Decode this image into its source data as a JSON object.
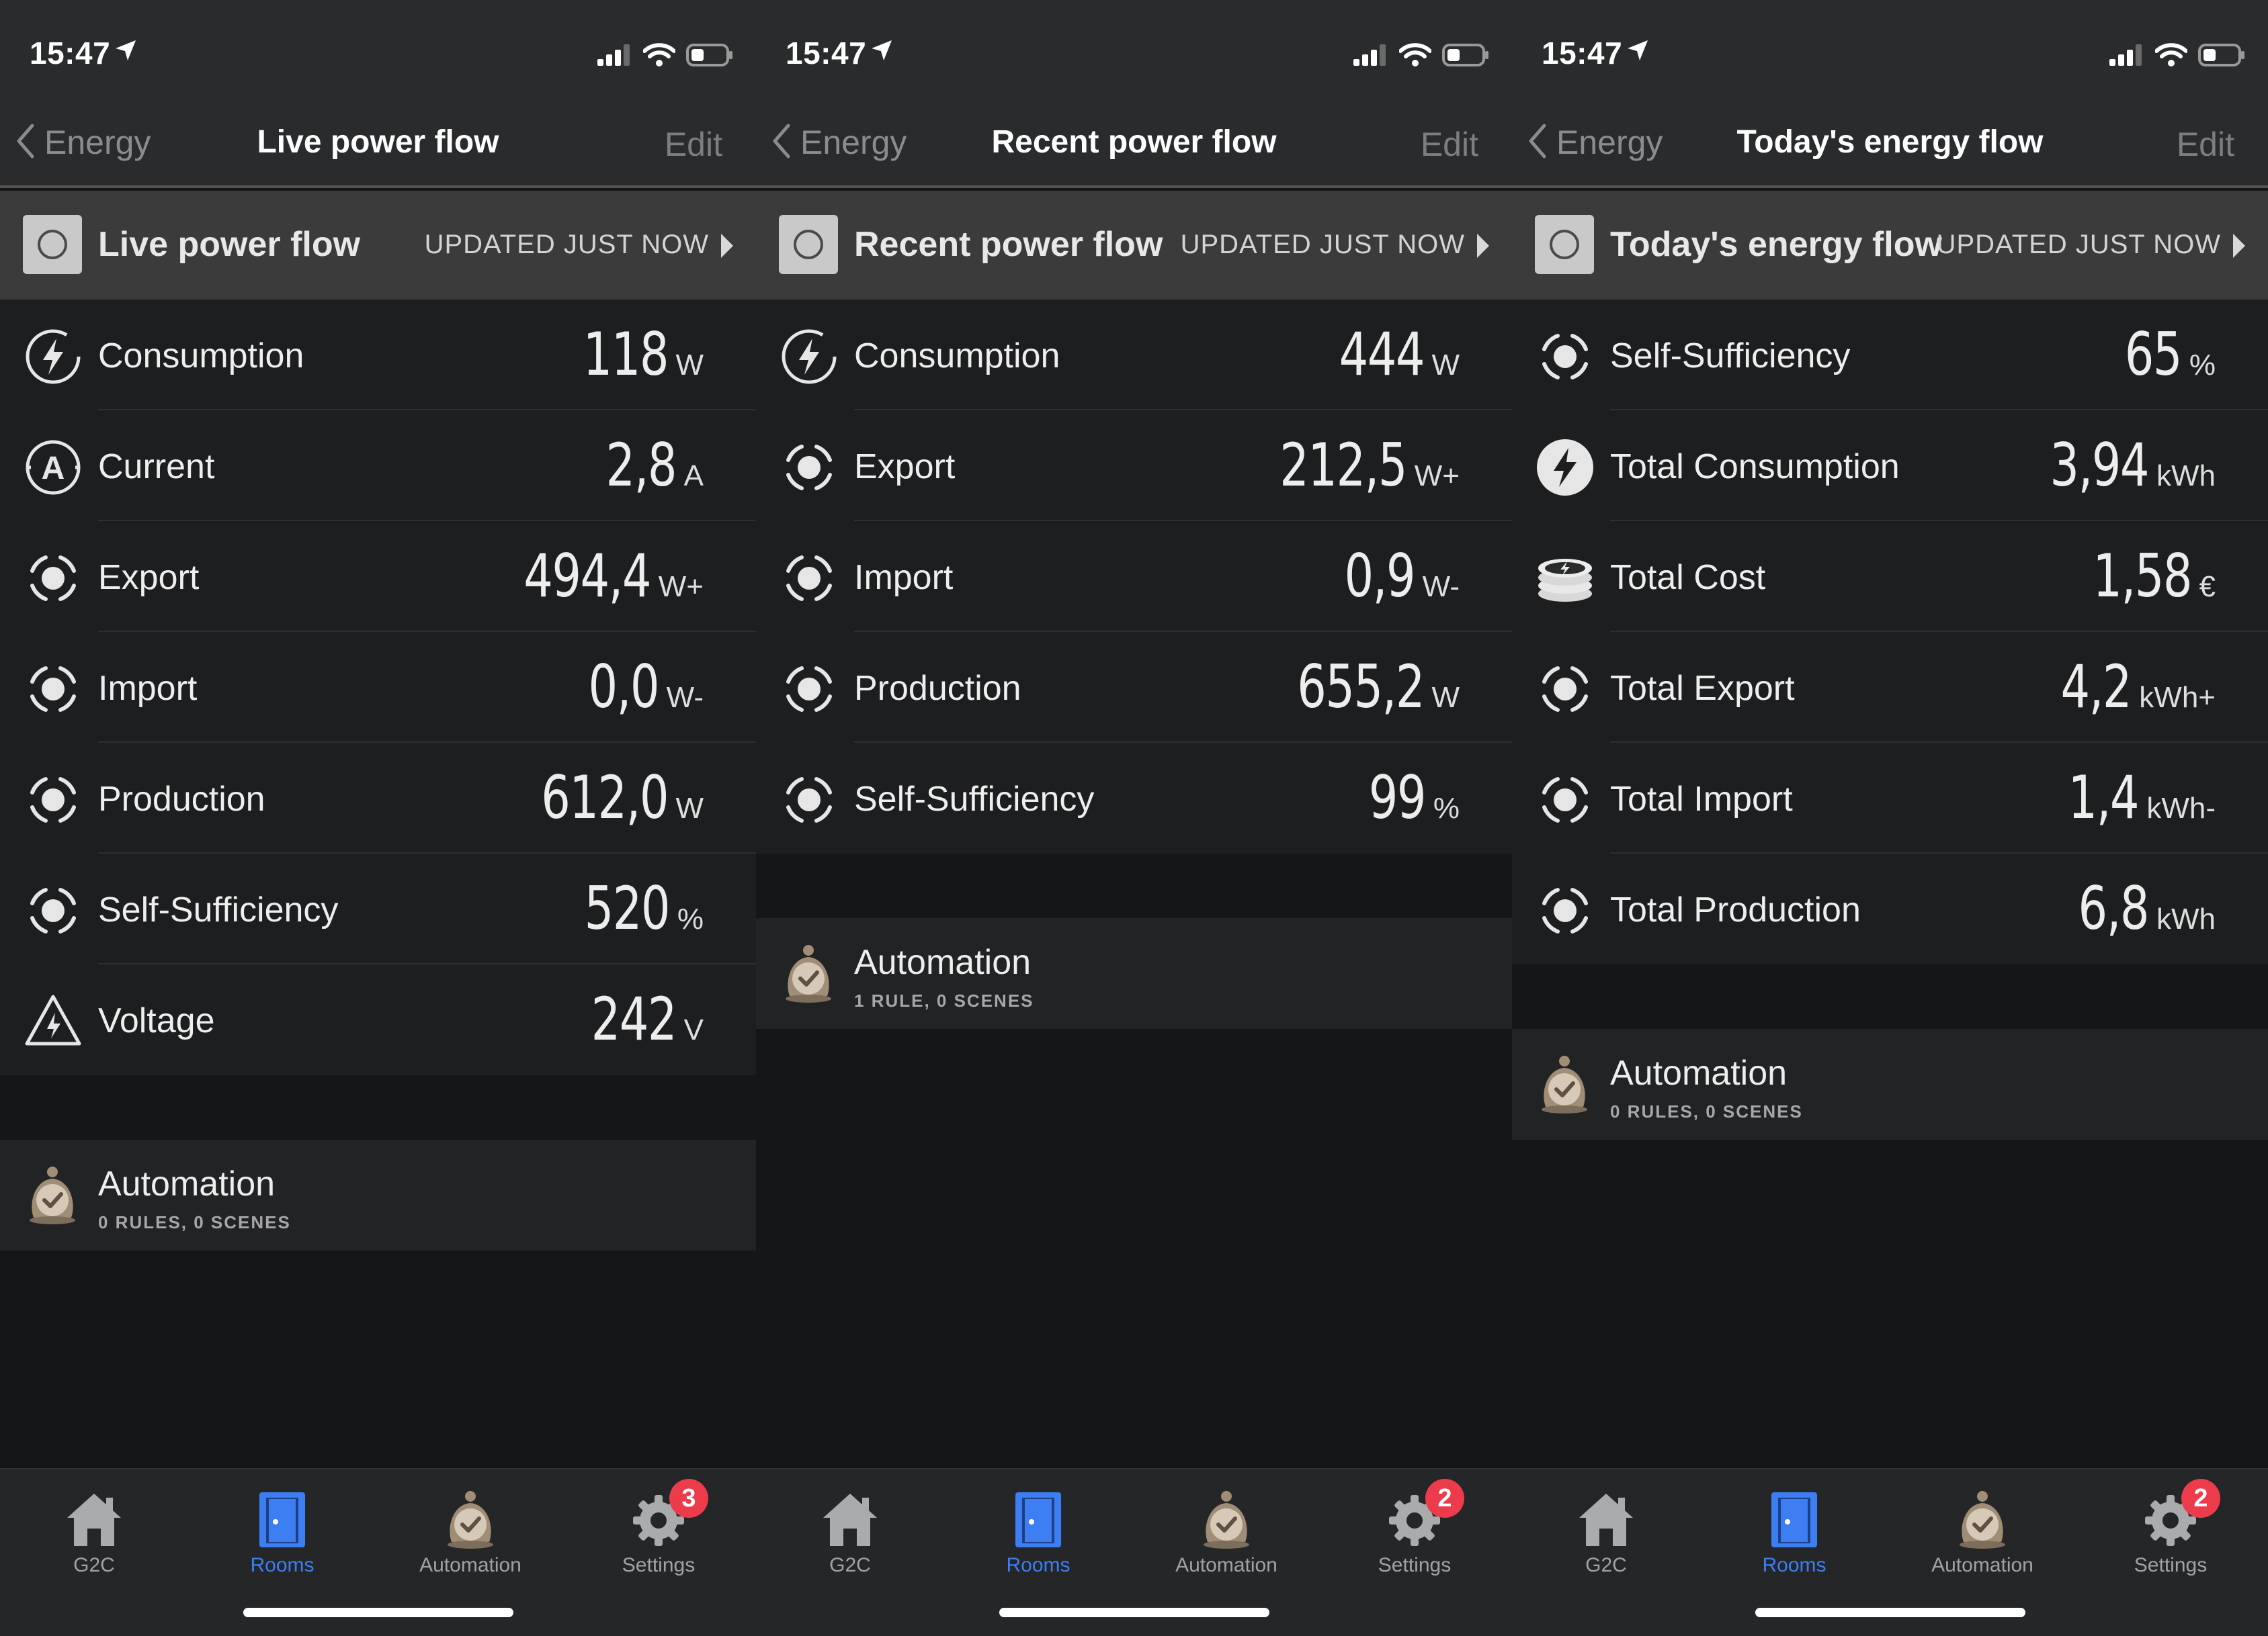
{
  "screens": [
    {
      "status_time": "15:47",
      "nav": {
        "back_label": "Energy",
        "title": "Live power flow",
        "edit_label": "Edit"
      },
      "header": {
        "title": "Live power flow",
        "updated": "UPDATED JUST NOW"
      },
      "rows": [
        {
          "icon": "lightning-circle-icon",
          "label": "Consumption",
          "value": "118",
          "unit": "W"
        },
        {
          "icon": "ampere-icon",
          "label": "Current",
          "value": "2,8",
          "unit": "A"
        },
        {
          "icon": "energy-meter-icon",
          "label": "Export",
          "value": "494,4",
          "unit": "W+"
        },
        {
          "icon": "energy-meter-icon",
          "label": "Import",
          "value": "0,0",
          "unit": "W-"
        },
        {
          "icon": "energy-meter-icon",
          "label": "Production",
          "value": "612,0",
          "unit": "W"
        },
        {
          "icon": "energy-meter-icon",
          "label": "Self-Sufficiency",
          "value": "520",
          "unit": "%"
        },
        {
          "icon": "voltage-warning-icon",
          "label": "Voltage",
          "value": "242",
          "unit": "V"
        }
      ],
      "automation": {
        "title": "Automation",
        "subtitle": "0 RULES, 0 SCENES"
      },
      "settings_badge": "3"
    },
    {
      "status_time": "15:47",
      "nav": {
        "back_label": "Energy",
        "title": "Recent power flow",
        "edit_label": "Edit"
      },
      "header": {
        "title": "Recent power flow",
        "updated": "UPDATED JUST NOW"
      },
      "rows": [
        {
          "icon": "lightning-circle-icon",
          "label": "Consumption",
          "value": "444",
          "unit": "W"
        },
        {
          "icon": "energy-meter-icon",
          "label": "Export",
          "value": "212,5",
          "unit": "W+"
        },
        {
          "icon": "energy-meter-icon",
          "label": "Import",
          "value": "0,9",
          "unit": "W-"
        },
        {
          "icon": "energy-meter-icon",
          "label": "Production",
          "value": "655,2",
          "unit": "W"
        },
        {
          "icon": "energy-meter-icon",
          "label": "Self-Sufficiency",
          "value": "99",
          "unit": "%"
        }
      ],
      "automation": {
        "title": "Automation",
        "subtitle": "1 RULE, 0 SCENES"
      },
      "settings_badge": "2"
    },
    {
      "status_time": "15:47",
      "nav": {
        "back_label": "Energy",
        "title": "Today's energy flow",
        "edit_label": "Edit"
      },
      "header": {
        "title": "Today's energy flow",
        "updated": "UPDATED JUST NOW"
      },
      "rows": [
        {
          "icon": "energy-meter-icon",
          "label": "Self-Sufficiency",
          "value": "65",
          "unit": "%"
        },
        {
          "icon": "lightning-filled-icon",
          "label": "Total Consumption",
          "value": "3,94",
          "unit": "kWh"
        },
        {
          "icon": "coin-stack-icon",
          "label": "Total Cost",
          "value": "1,58",
          "unit": "€"
        },
        {
          "icon": "energy-meter-icon",
          "label": "Total Export",
          "value": "4,2",
          "unit": "kWh+"
        },
        {
          "icon": "energy-meter-icon",
          "label": "Total Import",
          "value": "1,4",
          "unit": "kWh-"
        },
        {
          "icon": "energy-meter-icon",
          "label": "Total Production",
          "value": "6,8",
          "unit": "kWh"
        }
      ],
      "automation": {
        "title": "Automation",
        "subtitle": "0 RULES, 0 SCENES"
      },
      "settings_badge": "2"
    }
  ],
  "tabs": [
    {
      "label": "G2C",
      "icon": "home-icon"
    },
    {
      "label": "Rooms",
      "icon": "door-icon",
      "active": true
    },
    {
      "label": "Automation",
      "icon": "automation-icon"
    },
    {
      "label": "Settings",
      "icon": "gear-icon"
    }
  ],
  "colors": {
    "accent": "#3d7ef2",
    "badge": "#ec3b4a",
    "automation_icon": "#a08d76"
  }
}
